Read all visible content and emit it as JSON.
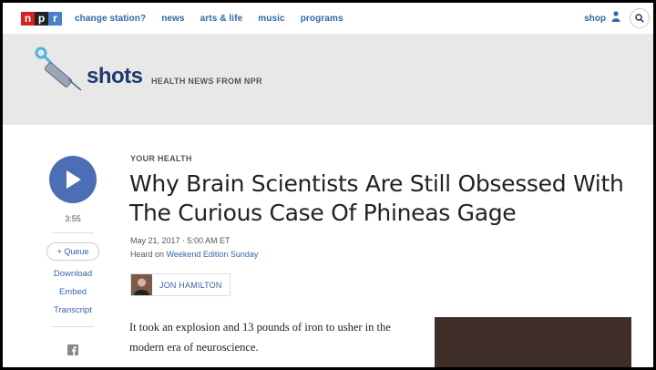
{
  "nav": {
    "logo_letters": [
      "n",
      "p",
      "r"
    ],
    "links": [
      "change station?",
      "news",
      "arts & life",
      "music",
      "programs"
    ],
    "shop_label": "shop"
  },
  "masthead": {
    "brand": "shots",
    "tagline": "HEALTH NEWS FROM NPR"
  },
  "audio": {
    "duration": "3:55",
    "queue_label": "+ Queue",
    "links": [
      "Download",
      "Embed",
      "Transcript"
    ]
  },
  "article": {
    "slug": "YOUR HEALTH",
    "headline": "Why Brain Scientists Are Still Obsessed With The Curious Case Of Phineas Gage",
    "date": "May 21, 2017 · 5:00 AM ET",
    "heard_on_prefix": "Heard on ",
    "heard_on_show": "Weekend Edition Sunday",
    "author": "JON HAMILTON",
    "body": "It took an explosion and 13 pounds of iron to usher in the modern era of neuroscience."
  },
  "colors": {
    "link": "#3366a6",
    "play": "#4c6eb5",
    "masthead_bg": "#e8e8e8",
    "npr_n": "#d62021",
    "npr_p": "#222222",
    "npr_r": "#4b7fc9"
  }
}
